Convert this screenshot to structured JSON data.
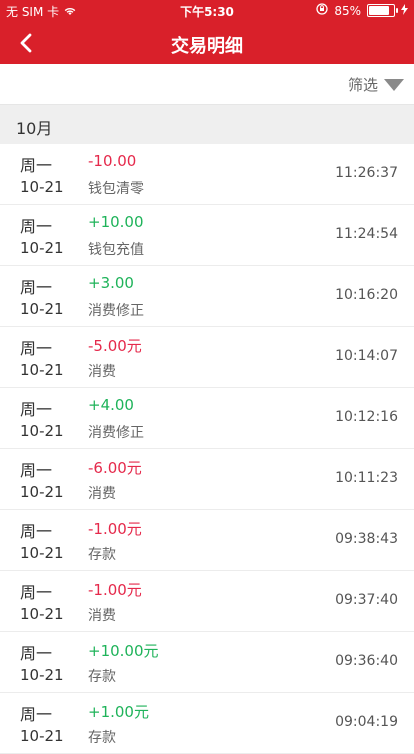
{
  "status": {
    "carrier": "无 SIM 卡",
    "time": "下午5:30",
    "battery_percent": "85%",
    "battery_level": 0.85
  },
  "nav": {
    "title": "交易明细"
  },
  "filter": {
    "label": "筛选"
  },
  "month": {
    "label": "10月"
  },
  "colors": {
    "header_red": "#d9202a",
    "negative_red": "#e5294b",
    "positive_green": "#1fb35a"
  },
  "transactions": [
    {
      "weekday": "周一",
      "date": "10-21",
      "amount": "-10.00",
      "type": "钱包清零",
      "time": "11:26:37",
      "sign": "neg"
    },
    {
      "weekday": "周一",
      "date": "10-21",
      "amount": "+10.00",
      "type": "钱包充值",
      "time": "11:24:54",
      "sign": "pos"
    },
    {
      "weekday": "周一",
      "date": "10-21",
      "amount": "+3.00",
      "type": "消费修正",
      "time": "10:16:20",
      "sign": "pos"
    },
    {
      "weekday": "周一",
      "date": "10-21",
      "amount": "-5.00元",
      "type": "消费",
      "time": "10:14:07",
      "sign": "neg"
    },
    {
      "weekday": "周一",
      "date": "10-21",
      "amount": "+4.00",
      "type": "消费修正",
      "time": "10:12:16",
      "sign": "pos"
    },
    {
      "weekday": "周一",
      "date": "10-21",
      "amount": "-6.00元",
      "type": "消费",
      "time": "10:11:23",
      "sign": "neg"
    },
    {
      "weekday": "周一",
      "date": "10-21",
      "amount": "-1.00元",
      "type": "存款",
      "time": "09:38:43",
      "sign": "neg"
    },
    {
      "weekday": "周一",
      "date": "10-21",
      "amount": "-1.00元",
      "type": "消费",
      "time": "09:37:40",
      "sign": "neg"
    },
    {
      "weekday": "周一",
      "date": "10-21",
      "amount": "+10.00元",
      "type": "存款",
      "time": "09:36:40",
      "sign": "pos"
    },
    {
      "weekday": "周一",
      "date": "10-21",
      "amount": "+1.00元",
      "type": "存款",
      "time": "09:04:19",
      "sign": "pos"
    }
  ]
}
